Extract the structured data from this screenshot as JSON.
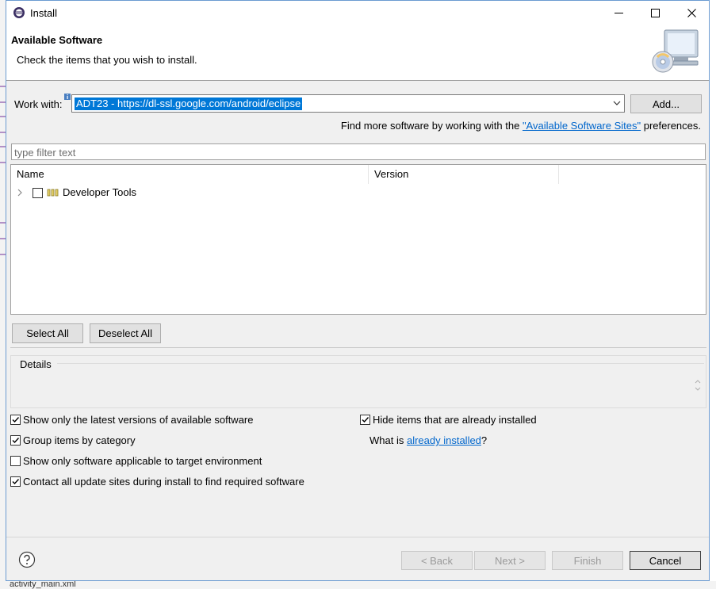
{
  "window": {
    "title": "Install",
    "controls": {
      "minimize_icon": "minimize-icon",
      "maximize_icon": "maximize-icon",
      "close_icon": "close-icon"
    }
  },
  "banner": {
    "title": "Available Software",
    "description": "Check the items that you wish to install."
  },
  "work_with": {
    "label": "Work with:",
    "value": "ADT23 - https://dl-ssl.google.com/android/eclipse",
    "add_label": "Add..."
  },
  "find_more": {
    "prefix": "Find more software by working with the ",
    "link": "\"Available Software Sites\"",
    "suffix": " preferences."
  },
  "filter": {
    "placeholder": "type filter text"
  },
  "tree": {
    "columns": [
      "Name",
      "Version"
    ],
    "rows": [
      {
        "name": "Developer Tools",
        "version": "",
        "checked": false,
        "expanded": false
      }
    ]
  },
  "selection": {
    "select_all": "Select All",
    "deselect_all": "Deselect All"
  },
  "details": {
    "label": "Details"
  },
  "options": [
    {
      "label": "Show only the latest versions of available software",
      "checked": true
    },
    {
      "label": "Group items by category",
      "checked": true
    },
    {
      "label": "Show only software applicable to target environment",
      "checked": false
    },
    {
      "label": "Contact all update sites during install to find required software",
      "checked": true
    }
  ],
  "right_options": {
    "hide_installed": {
      "label": "Hide items that are already installed",
      "checked": true
    },
    "what_is": {
      "prefix": "What is ",
      "link": "already installed",
      "suffix": "?"
    }
  },
  "footer": {
    "back": "< Back",
    "next": "Next >",
    "finish": "Finish",
    "cancel": "Cancel"
  },
  "background": {
    "tab_text": "activity_main.xml"
  },
  "colors": {
    "selection": "#0078d7",
    "link": "#0066cc",
    "dialog_bg": "#f0f0f0",
    "accent_border": "#6b9bd1"
  }
}
